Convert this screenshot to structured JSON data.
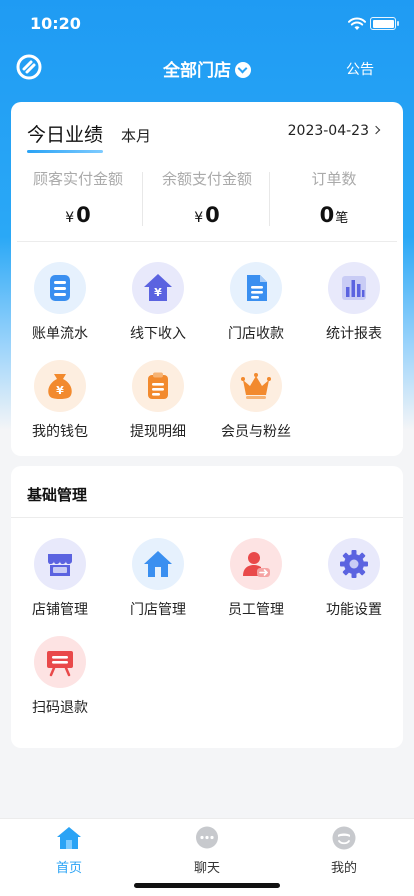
{
  "status_bar": {
    "time": "10:20"
  },
  "navbar": {
    "store_name": "全部门店",
    "notice": "公告"
  },
  "summary": {
    "tab_today": "今日业绩",
    "tab_month": "本月",
    "date": "2023-04-23",
    "stats": [
      {
        "label": "顾客实付金额",
        "currency": "¥",
        "value": "0",
        "unit": ""
      },
      {
        "label": "余额支付金额",
        "currency": "¥",
        "value": "0",
        "unit": ""
      },
      {
        "label": "订单数",
        "currency": "",
        "value": "0",
        "unit": "笔"
      }
    ]
  },
  "quick_actions": [
    {
      "label": "账单流水",
      "icon": "bill-list-icon"
    },
    {
      "label": "线下收入",
      "icon": "offline-income-icon"
    },
    {
      "label": "门店收款",
      "icon": "store-collection-icon"
    },
    {
      "label": "统计报表",
      "icon": "stats-report-icon"
    },
    {
      "label": "我的钱包",
      "icon": "wallet-icon"
    },
    {
      "label": "提现明细",
      "icon": "withdraw-detail-icon"
    },
    {
      "label": "会员与粉丝",
      "icon": "crown-icon"
    }
  ],
  "basic_management": {
    "title": "基础管理",
    "items": [
      {
        "label": "店铺管理",
        "icon": "shop-icon"
      },
      {
        "label": "门店管理",
        "icon": "house-icon"
      },
      {
        "label": "员工管理",
        "icon": "staff-icon"
      },
      {
        "label": "功能设置",
        "icon": "gear-icon"
      },
      {
        "label": "扫码退款",
        "icon": "scan-refund-icon"
      }
    ]
  },
  "tabbar": [
    {
      "label": "首页",
      "icon": "home-icon",
      "active": true
    },
    {
      "label": "聊天",
      "icon": "chat-icon",
      "active": false
    },
    {
      "label": "我的",
      "icon": "profile-icon",
      "active": false
    }
  ],
  "colors": {
    "primary": "#2aa3f5",
    "purple": "#5b63e0",
    "orange": "#f28a2e",
    "red": "#e9494a"
  }
}
